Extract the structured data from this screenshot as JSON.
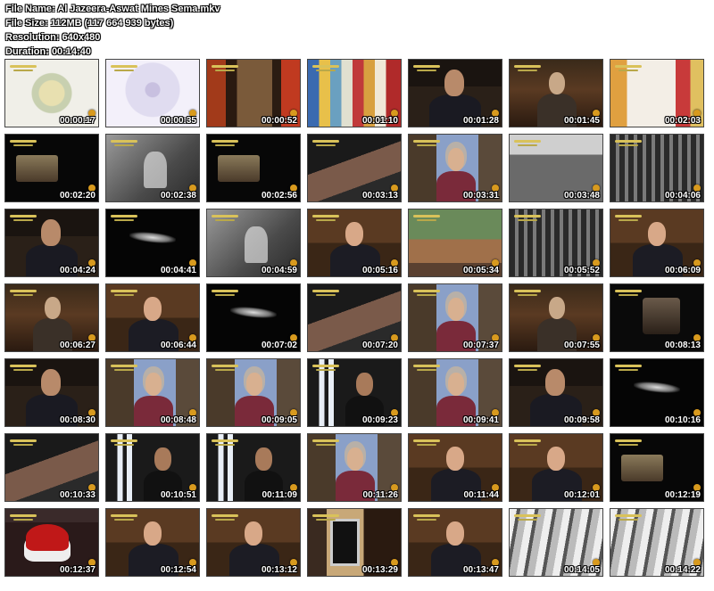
{
  "info": {
    "file_name": "File Name: Al Jazeera-Aswat Mines Sema.mkv",
    "file_size": "File Size: 112MB (117 664 939 bytes)",
    "resolution": "Resolution: 640x480",
    "duration": "Duration: 00:14:40"
  },
  "thumbnails": [
    {
      "time": "00:00:17",
      "scene": "s-ornament"
    },
    {
      "time": "00:00:35",
      "scene": "s-ornament2"
    },
    {
      "time": "00:00:52",
      "scene": "s-arch"
    },
    {
      "time": "00:01:10",
      "scene": "s-stripes"
    },
    {
      "time": "00:01:28",
      "scene": "s-man"
    },
    {
      "time": "00:01:45",
      "scene": "s-room"
    },
    {
      "time": "00:02:03",
      "scene": "s-cloth"
    },
    {
      "time": "00:02:20",
      "scene": "s-radio"
    },
    {
      "time": "00:02:38",
      "scene": "s-bw"
    },
    {
      "time": "00:02:56",
      "scene": "s-radio"
    },
    {
      "time": "00:03:13",
      "scene": "s-book"
    },
    {
      "time": "00:03:31",
      "scene": "s-woman"
    },
    {
      "time": "00:03:48",
      "scene": "s-crowd"
    },
    {
      "time": "00:04:06",
      "scene": "s-crowd2"
    },
    {
      "time": "00:04:24",
      "scene": "s-man"
    },
    {
      "time": "00:04:41",
      "scene": "s-light"
    },
    {
      "time": "00:04:59",
      "scene": "s-bw"
    },
    {
      "time": "00:05:16",
      "scene": "s-suit"
    },
    {
      "time": "00:05:34",
      "scene": "s-garden"
    },
    {
      "time": "00:05:52",
      "scene": "s-crowd2"
    },
    {
      "time": "00:06:09",
      "scene": "s-suit"
    },
    {
      "time": "00:06:27",
      "scene": "s-room"
    },
    {
      "time": "00:06:44",
      "scene": "s-suit"
    },
    {
      "time": "00:07:02",
      "scene": "s-light"
    },
    {
      "time": "00:07:20",
      "scene": "s-book"
    },
    {
      "time": "00:07:37",
      "scene": "s-woman"
    },
    {
      "time": "00:07:55",
      "scene": "s-room"
    },
    {
      "time": "00:08:13",
      "scene": "s-tv"
    },
    {
      "time": "00:08:30",
      "scene": "s-man"
    },
    {
      "time": "00:08:48",
      "scene": "s-woman"
    },
    {
      "time": "00:09:05",
      "scene": "s-woman"
    },
    {
      "time": "00:09:23",
      "scene": "s-window"
    },
    {
      "time": "00:09:41",
      "scene": "s-woman"
    },
    {
      "time": "00:09:58",
      "scene": "s-man"
    },
    {
      "time": "00:10:16",
      "scene": "s-light"
    },
    {
      "time": "00:10:33",
      "scene": "s-book"
    },
    {
      "time": "00:10:51",
      "scene": "s-window"
    },
    {
      "time": "00:11:09",
      "scene": "s-window"
    },
    {
      "time": "00:11:26",
      "scene": "s-woman"
    },
    {
      "time": "00:11:44",
      "scene": "s-suit"
    },
    {
      "time": "00:12:01",
      "scene": "s-suit"
    },
    {
      "time": "00:12:19",
      "scene": "s-radio"
    },
    {
      "time": "00:12:37",
      "scene": "s-hat"
    },
    {
      "time": "00:12:54",
      "scene": "s-suit"
    },
    {
      "time": "00:13:12",
      "scene": "s-suit"
    },
    {
      "time": "00:13:29",
      "scene": "s-sepia"
    },
    {
      "time": "00:13:47",
      "scene": "s-suit"
    },
    {
      "time": "00:14:05",
      "scene": "s-bwcrowd"
    },
    {
      "time": "00:14:22",
      "scene": "s-bwcrowd"
    }
  ]
}
